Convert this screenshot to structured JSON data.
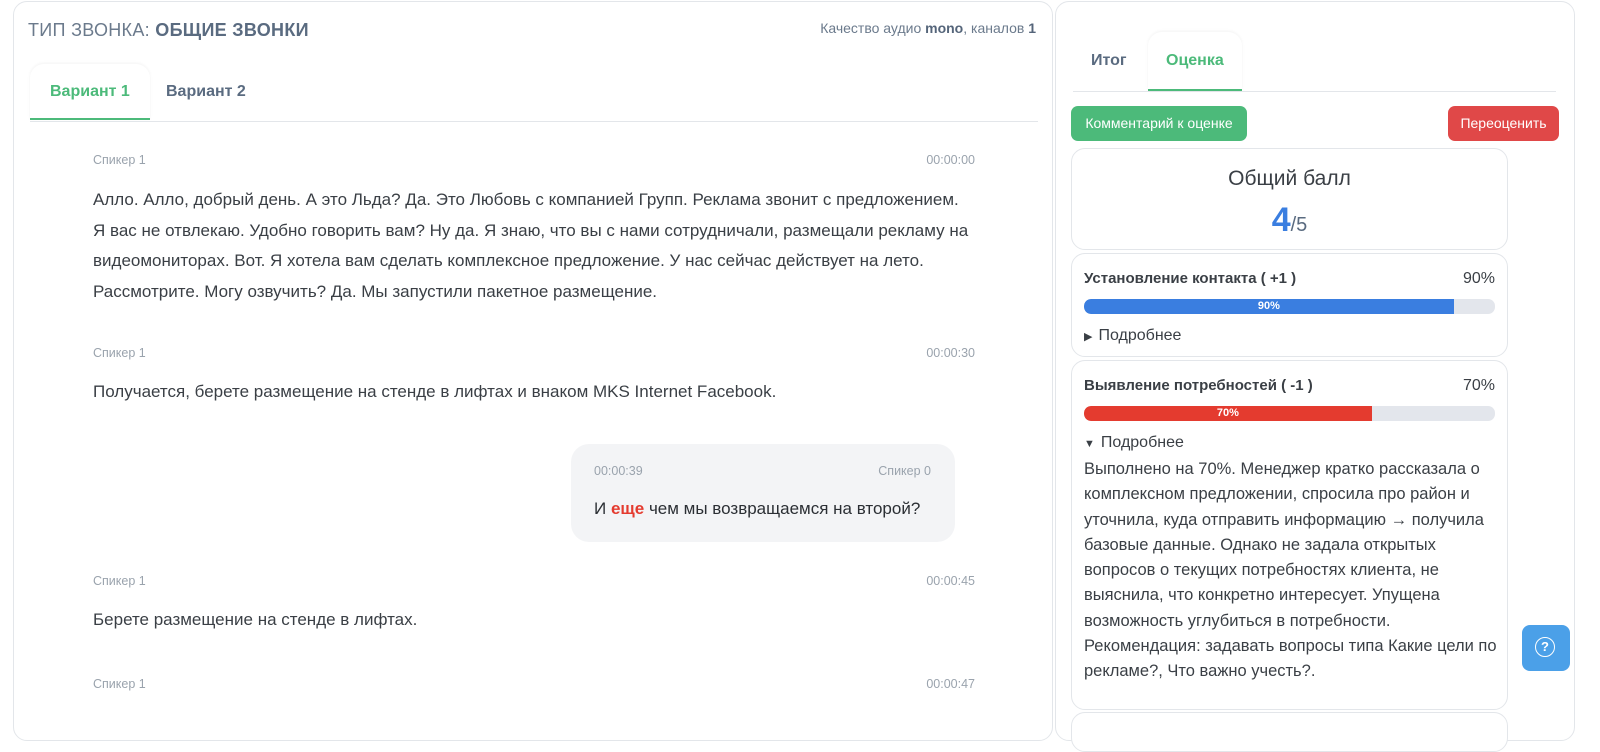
{
  "header": {
    "call_type_label": "ТИП ЗВОНКА:",
    "call_type_value": "ОБЩИЕ ЗВОНКИ",
    "audio_quality_prefix": "Качество аудио ",
    "audio_mode": "mono",
    "channels_label": ", каналов ",
    "channels_value": "1"
  },
  "variant_tabs": [
    {
      "label": "Вариант 1",
      "active": true
    },
    {
      "label": "Вариант 2",
      "active": false
    }
  ],
  "transcript": [
    {
      "speaker": "Спикер 1",
      "time": "00:00:00",
      "text": "Алло. Алло, добрый день. А это Льда? Да. Это Любовь с компанией Групп. Реклама звонит с предложением. Я вас не отвлекаю. Удобно говорить вам? Ну да. Я знаю, что вы с нами сотрудничали, размещали рекламу на видеомониторах. Вот. Я хотела вам сделать комплексное предложение. У нас сейчас действует на лето. Рассмотрите. Могу озвучить? Да. Мы запустили пакетное размещение."
    },
    {
      "speaker": "Спикер 1",
      "time": "00:00:30",
      "text": "Получается, берете размещение на стенде в лифтах и внаком MKS Internet Facebook."
    },
    {
      "speaker": "Спикер 0",
      "time": "00:00:39",
      "text_before": "И ",
      "highlight": "еще",
      "text_after": " чем мы возвращаемся на второй?"
    },
    {
      "speaker": "Спикер 1",
      "time": "00:00:45",
      "text": "Берете размещение на стенде в лифтах."
    },
    {
      "speaker": "Спикер 1",
      "time": "00:00:47",
      "text": ""
    }
  ],
  "right_tabs": [
    {
      "label": "Итог",
      "active": false
    },
    {
      "label": "Оценка",
      "active": true
    }
  ],
  "buttons": {
    "comment": "Комментарий к оценке",
    "reevaluate": "Переоценить"
  },
  "score": {
    "title": "Общий балл",
    "value": "4",
    "max": "/5"
  },
  "criteria": [
    {
      "title": "Установление контакта ( +1 )",
      "percent": "90%",
      "fraction": 0.9,
      "color": "#3a7ee0",
      "more_label": "Подробнее",
      "expanded": false
    },
    {
      "title": "Выявление потребностей ( -1 )",
      "percent": "70%",
      "fraction": 0.7,
      "color": "#e43b2f",
      "more_label": "Подробнее",
      "expanded": true,
      "detail": "Выполнено на 70%. Менеджер кратко рассказала о комплексном предложении, спросила про район и уточнила, куда отправить информацию → получила базовые данные. Однако не задала открытых вопросов о текущих потребностях клиента, не выяснила, что конкретно интересует. Упущена возможность углубиться в потребности. Рекомендация: задавать вопросы типа Какие цели по рекламе?, Что важно учесть?."
    }
  ],
  "help": {
    "icon": "question-icon",
    "glyph": "?"
  },
  "colors": {
    "accent_green": "#4cba7a",
    "accent_red": "#e04848",
    "accent_blue": "#3a7ee0"
  }
}
